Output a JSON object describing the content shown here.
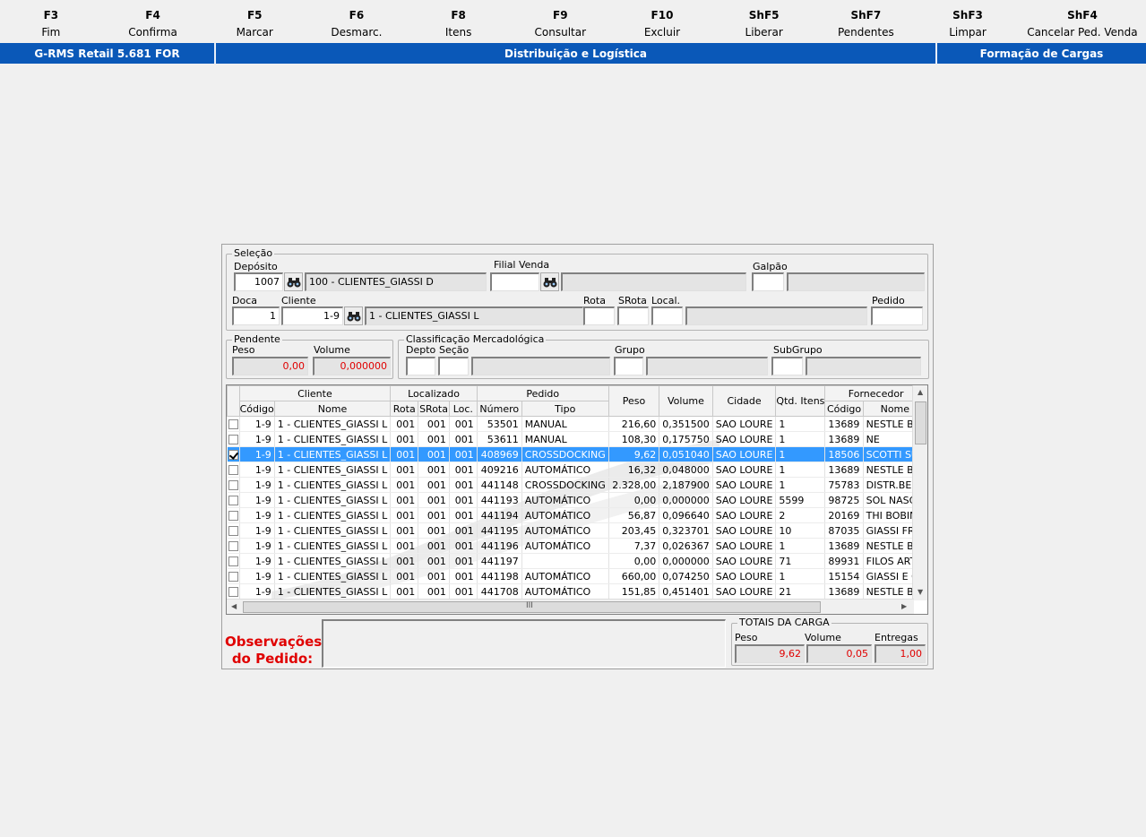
{
  "fkeys": [
    {
      "key": "F3",
      "label": "Fim"
    },
    {
      "key": "F4",
      "label": "Confirma"
    },
    {
      "key": "F5",
      "label": "Marcar"
    },
    {
      "key": "F6",
      "label": "Desmarc."
    },
    {
      "key": "F8",
      "label": "Itens"
    },
    {
      "key": "F9",
      "label": "Consultar"
    },
    {
      "key": "F10",
      "label": "Excluir"
    },
    {
      "key": "ShF5",
      "label": "Liberar"
    },
    {
      "key": "ShF7",
      "label": "Pendentes"
    },
    {
      "key": "ShF3",
      "label": "Limpar"
    },
    {
      "key": "ShF4",
      "label": "Cancelar Ped. Venda"
    }
  ],
  "titlebar": {
    "app": "G-RMS Retail 5.681 FOR",
    "module": "Distribuição e Logística",
    "screen": "Formação de Cargas"
  },
  "selecao": {
    "legend": "Seleção",
    "deposito_label": "Depósito",
    "deposito_value": "1007",
    "deposito_desc": "100 - CLIENTES_GIASSI D",
    "filial_label": "Filial Venda",
    "filial_value": "",
    "filial_desc": "",
    "galpao_label": "Galpão",
    "galpao_value": "",
    "galpao_desc": "",
    "doca_label": "Doca",
    "doca_value": "1",
    "cliente_label": "Cliente",
    "cliente_value": "1-9",
    "cliente_desc": "1 - CLIENTES_GIASSI L",
    "rota_label": "Rota",
    "srota_label": "SRota",
    "local_label": "Local.",
    "pedido_label": "Pedido"
  },
  "pendente": {
    "legend": "Pendente",
    "peso_label": "Peso",
    "peso_value": "0,00",
    "volume_label": "Volume",
    "volume_value": "0,000000"
  },
  "classif": {
    "legend": "Classificação Mercadológica",
    "depto_label": "Depto",
    "secao_label": "Seção",
    "grupo_label": "Grupo",
    "subgrupo_label": "SubGrupo"
  },
  "grid": {
    "group_headers": {
      "cliente": "Cliente",
      "localizado": "Localizado",
      "pedido": "Pedido",
      "fornecedor": "Fornecedor"
    },
    "headers": {
      "cli_codigo": "Código",
      "cli_nome": "Nome",
      "rota": "Rota",
      "srota": "SRota",
      "loc": "Loc.",
      "numero": "Número",
      "tipo": "Tipo",
      "peso": "Peso",
      "volume": "Volume",
      "cidade": "Cidade",
      "qtd": "Qtd. Itens",
      "for_codigo": "Código",
      "for_nome": "Nome"
    },
    "rows": [
      {
        "checked": false,
        "codigo": "1-9",
        "nome": "1 - CLIENTES_GIASSI L",
        "rota": "001",
        "srota": "001",
        "loc": "001",
        "numero": "53501",
        "tipo": "MANUAL",
        "peso": "216,60",
        "volume": "0,351500",
        "cidade": "SAO LOURE",
        "qtd": "1",
        "fcod": "13689",
        "fnome": "NESTLE BR"
      },
      {
        "checked": false,
        "codigo": "1-9",
        "nome": "1 - CLIENTES_GIASSI L",
        "rota": "001",
        "srota": "001",
        "loc": "001",
        "numero": "53611",
        "tipo": "MANUAL",
        "peso": "108,30",
        "volume": "0,175750",
        "cidade": "SAO LOURE",
        "qtd": "1",
        "fcod": "13689",
        "fnome": "NE"
      },
      {
        "checked": true,
        "selected": true,
        "codigo": "1-9",
        "nome": "1 - CLIENTES_GIASSI L",
        "rota": "001",
        "srota": "001",
        "loc": "001",
        "numero": "408969",
        "tipo": "CROSSDOCKING",
        "peso": "9,62",
        "volume": "0,051040",
        "cidade": "SAO LOURE",
        "qtd": "1",
        "fcod": "18506",
        "fnome": "SCOTTI SU"
      },
      {
        "checked": false,
        "codigo": "1-9",
        "nome": "1 - CLIENTES_GIASSI L",
        "rota": "001",
        "srota": "001",
        "loc": "001",
        "numero": "409216",
        "tipo": "AUTOMÁTICO",
        "peso": "16,32",
        "volume": "0,048000",
        "cidade": "SAO LOURE",
        "qtd": "1",
        "fcod": "13689",
        "fnome": "NESTLE BR"
      },
      {
        "checked": false,
        "codigo": "1-9",
        "nome": "1 - CLIENTES_GIASSI L",
        "rota": "001",
        "srota": "001",
        "loc": "001",
        "numero": "441148",
        "tipo": "CROSSDOCKING",
        "peso": "2.328,00",
        "volume": "2,187900",
        "cidade": "SAO LOURE",
        "qtd": "1",
        "fcod": "75783",
        "fnome": "DISTR.BEB"
      },
      {
        "checked": false,
        "codigo": "1-9",
        "nome": "1 - CLIENTES_GIASSI L",
        "rota": "001",
        "srota": "001",
        "loc": "001",
        "numero": "441193",
        "tipo": "AUTOMÁTICO",
        "peso": "0,00",
        "volume": "0,000000",
        "cidade": "SAO LOURE",
        "qtd": "5599",
        "fcod": "98725",
        "fnome": "SOL NASC"
      },
      {
        "checked": false,
        "codigo": "1-9",
        "nome": "1 - CLIENTES_GIASSI L",
        "rota": "001",
        "srota": "001",
        "loc": "001",
        "numero": "441194",
        "tipo": "AUTOMÁTICO",
        "peso": "56,87",
        "volume": "0,096640",
        "cidade": "SAO LOURE",
        "qtd": "2",
        "fcod": "20169",
        "fnome": "THI BOBINA"
      },
      {
        "checked": false,
        "codigo": "1-9",
        "nome": "1 - CLIENTES_GIASSI L",
        "rota": "001",
        "srota": "001",
        "loc": "001",
        "numero": "441195",
        "tipo": "AUTOMÁTICO",
        "peso": "203,45",
        "volume": "0,323701",
        "cidade": "SAO LOURE",
        "qtd": "10",
        "fcod": "87035",
        "fnome": "GIASSI FRI"
      },
      {
        "checked": false,
        "codigo": "1-9",
        "nome": "1 - CLIENTES_GIASSI L",
        "rota": "001",
        "srota": "001",
        "loc": "001",
        "numero": "441196",
        "tipo": "AUTOMÁTICO",
        "peso": "7,37",
        "volume": "0,026367",
        "cidade": "SAO LOURE",
        "qtd": "1",
        "fcod": "13689",
        "fnome": "NESTLE BR"
      },
      {
        "checked": false,
        "codigo": "1-9",
        "nome": "1 - CLIENTES_GIASSI L",
        "rota": "001",
        "srota": "001",
        "loc": "001",
        "numero": "441197",
        "tipo": "",
        "peso": "0,00",
        "volume": "0,000000",
        "cidade": "SAO LOURE",
        "qtd": "71",
        "fcod": "89931",
        "fnome": "FILOS ART"
      },
      {
        "checked": false,
        "codigo": "1-9",
        "nome": "1 - CLIENTES_GIASSI L",
        "rota": "001",
        "srota": "001",
        "loc": "001",
        "numero": "441198",
        "tipo": "AUTOMÁTICO",
        "peso": "660,00",
        "volume": "0,074250",
        "cidade": "SAO LOURE",
        "qtd": "1",
        "fcod": "15154",
        "fnome": "GIASSI E C"
      },
      {
        "checked": false,
        "codigo": "1-9",
        "nome": "1 - CLIENTES_GIASSI L",
        "rota": "001",
        "srota": "001",
        "loc": "001",
        "numero": "441708",
        "tipo": "AUTOMÁTICO",
        "peso": "151,85",
        "volume": "0,451401",
        "cidade": "SAO LOURE",
        "qtd": "21",
        "fcod": "13689",
        "fnome": "NESTLE BR"
      }
    ],
    "hscroll_grip": "III"
  },
  "observacoes": {
    "line1": "Observações",
    "line2": "do Pedido:"
  },
  "totais": {
    "legend": "TOTAIS DA CARGA",
    "peso_label": "Peso",
    "peso_value": "9,62",
    "volume_label": "Volume",
    "volume_value": "0,05",
    "entregas_label": "Entregas",
    "entregas_value": "1,00"
  },
  "colors": {
    "titlebar": "#0a58b8",
    "selected_row": "#3399ff",
    "alert_text": "#e00000"
  }
}
